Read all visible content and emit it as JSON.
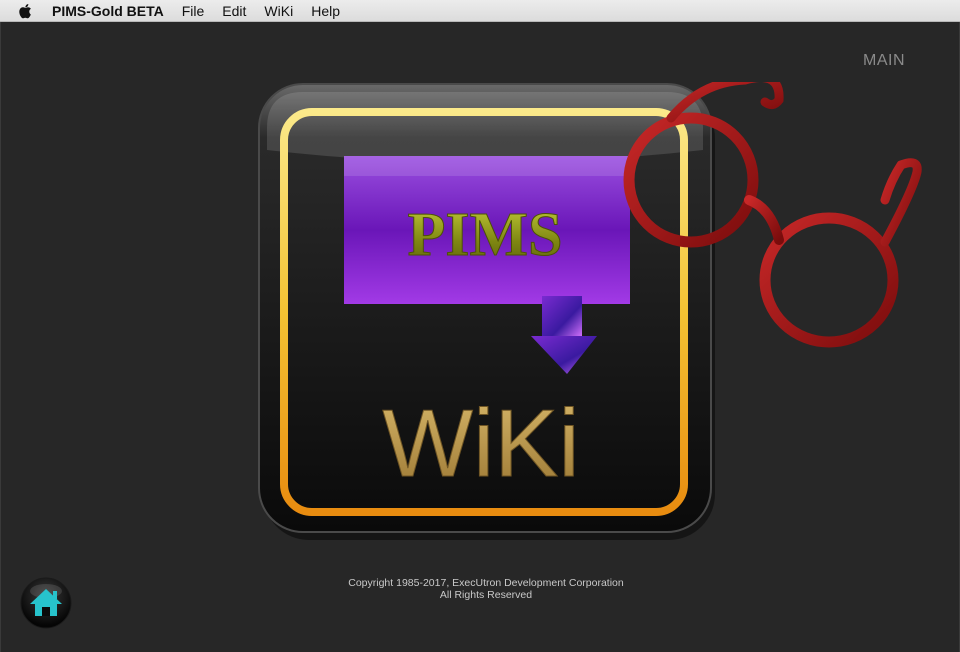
{
  "menubar": {
    "apple_icon": "apple-icon",
    "app_name": "PIMS-Gold BETA",
    "items": [
      "File",
      "Edit",
      "WiKi",
      "Help"
    ]
  },
  "page": {
    "section_label": "MAIN"
  },
  "logo": {
    "top_text": "PIMS",
    "bottom_text": "WiKi",
    "icon": "glasses-icon"
  },
  "footer": {
    "copyright": "Copyright 1985-2017, ExecUtron Development Corporation",
    "rights": "All Rights Reserved"
  },
  "home_button": {
    "icon": "home-icon"
  },
  "colors": {
    "background": "#272727",
    "frame_gold_top": "#f7e27a",
    "frame_gold_bottom": "#e99513",
    "purple": "#7a1fbf",
    "pims_text": "#8f9a18",
    "wiki_text": "#b8944a",
    "glasses_red": "#a01818",
    "home_teal": "#1fc0c8"
  }
}
